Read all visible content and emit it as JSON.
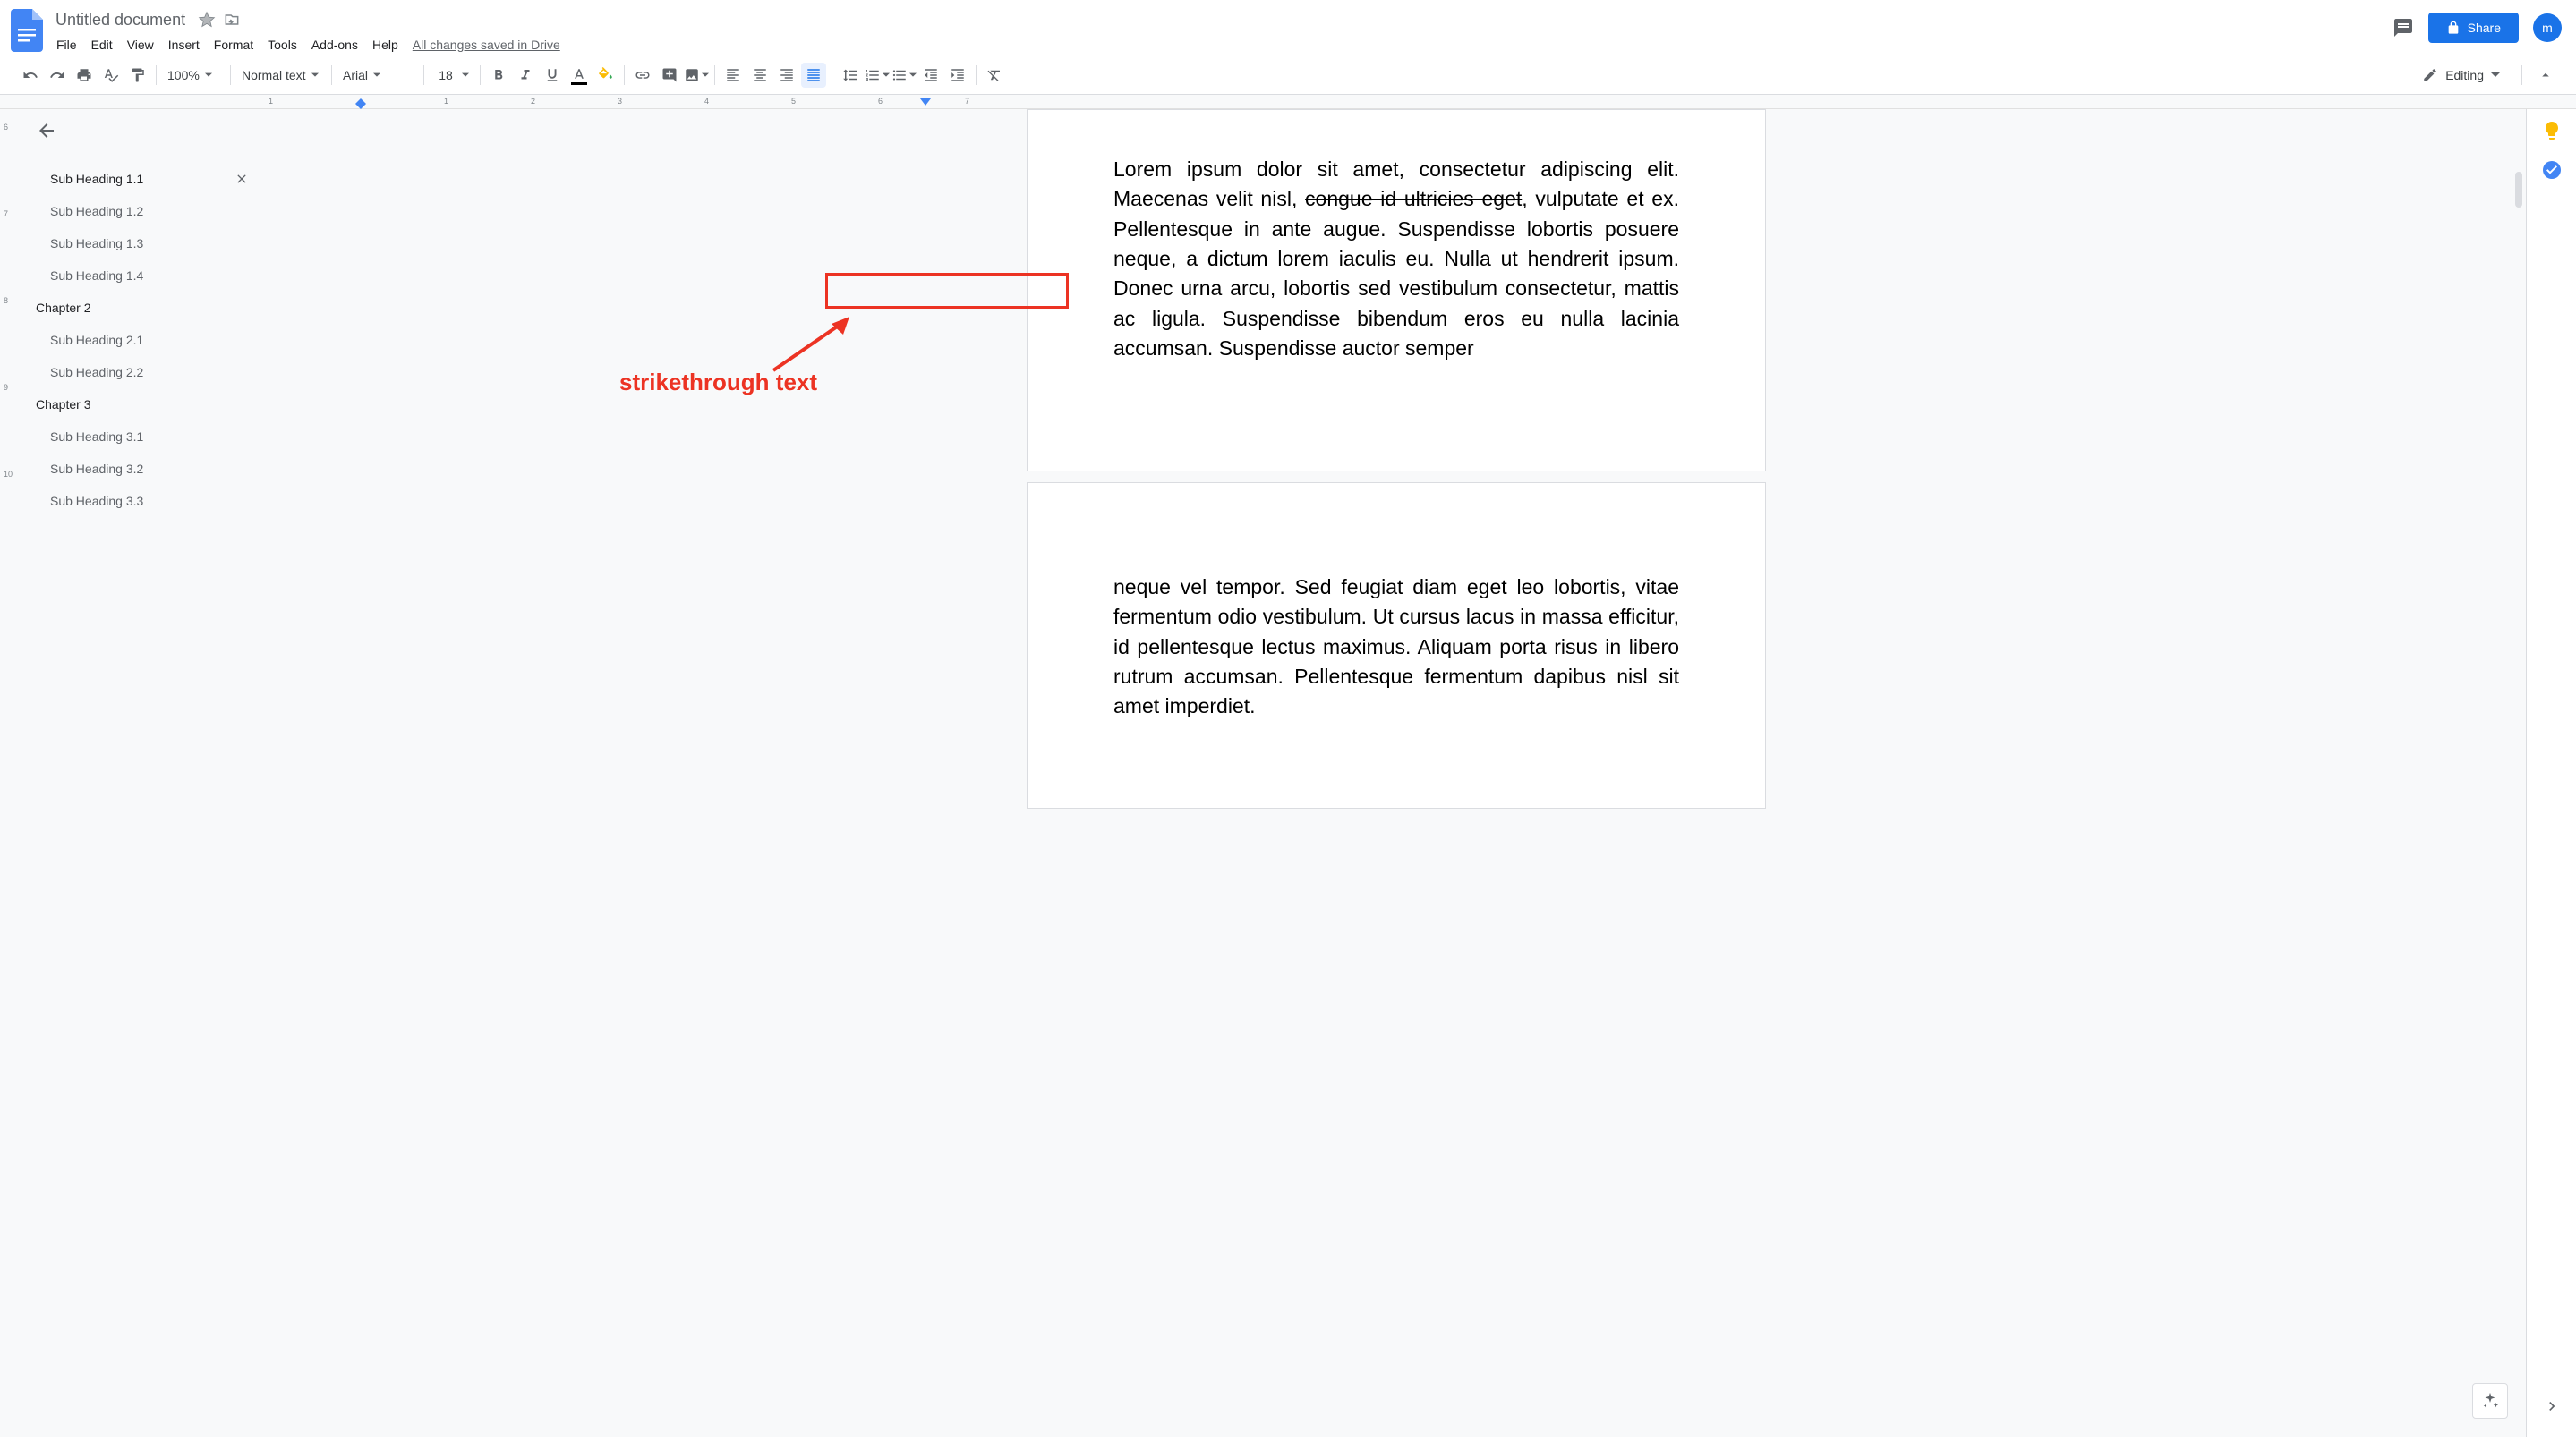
{
  "header": {
    "title": "Untitled document",
    "save_status": "All changes saved in Drive",
    "share_label": "Share",
    "avatar_letter": "m"
  },
  "menu": {
    "items": [
      "File",
      "Edit",
      "View",
      "Insert",
      "Format",
      "Tools",
      "Add-ons",
      "Help"
    ]
  },
  "toolbar": {
    "zoom": "100%",
    "style": "Normal text",
    "font": "Arial",
    "size": "18",
    "editing_label": "Editing"
  },
  "ruler": {
    "marks": [
      "1",
      "1",
      "2",
      "3",
      "4",
      "5",
      "6",
      "7"
    ]
  },
  "vruler": {
    "marks": [
      "6",
      "7",
      "8",
      "9",
      "10"
    ]
  },
  "outline": {
    "items": [
      {
        "label": "Sub Heading 1.1",
        "type": "sub",
        "active": true
      },
      {
        "label": "Sub Heading 1.2",
        "type": "sub"
      },
      {
        "label": "Sub Heading 1.3",
        "type": "sub"
      },
      {
        "label": "Sub Heading 1.4",
        "type": "sub"
      },
      {
        "label": "Chapter 2",
        "type": "chapter"
      },
      {
        "label": "Sub Heading 2.1",
        "type": "sub"
      },
      {
        "label": "Sub Heading 2.2",
        "type": "sub"
      },
      {
        "label": "Chapter 3",
        "type": "chapter"
      },
      {
        "label": "Sub Heading 3.1",
        "type": "sub"
      },
      {
        "label": "Sub Heading 3.2",
        "type": "sub"
      },
      {
        "label": "Sub Heading 3.3",
        "type": "sub"
      }
    ]
  },
  "document": {
    "page1_pre": "Lorem ipsum dolor sit amet, consectetur adipiscing elit. Maecenas velit nisl, ",
    "page1_strike": "congue id ultricies eget",
    "page1_post": ", vulputate et ex. Pellentesque in ante augue. Suspendisse lobortis posuere neque, a dictum lorem iaculis eu. Nulla ut hendrerit ipsum. Donec urna arcu, lobortis sed vestibulum consectetur, mattis ac ligula. Suspendisse bibendum eros eu nulla lacinia accumsan. Suspendisse auctor semper",
    "page2": "neque vel tempor. Sed feugiat diam eget leo lobortis, vitae fermentum odio vestibulum. Ut cursus lacus in massa efficitur, id pellentesque lectus maximus. Aliquam porta risus in libero rutrum accumsan. Pellentesque fermentum dapibus nisl sit amet imperdiet."
  },
  "annotation": {
    "label": "strikethrough text"
  }
}
